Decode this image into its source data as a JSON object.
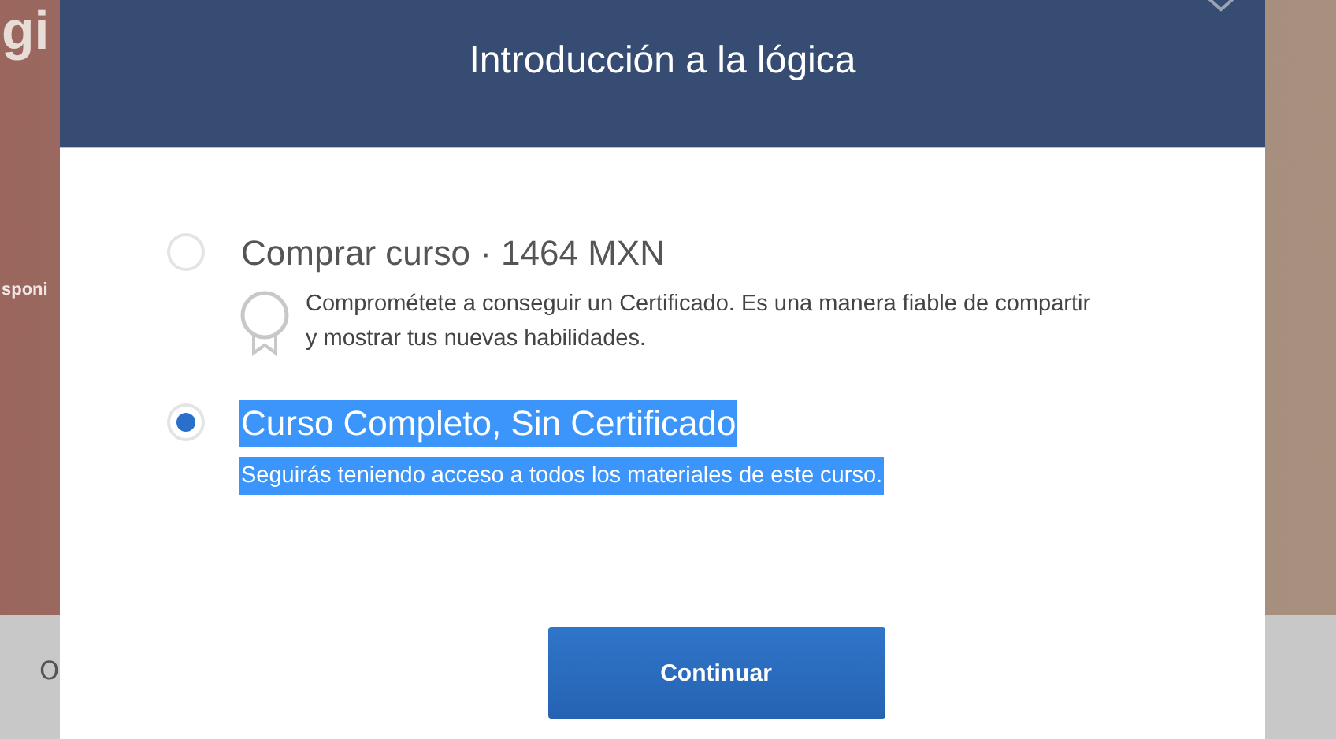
{
  "background": {
    "heading_fragment": "gi",
    "text_fragment": "sponi",
    "footer_fragment": "O"
  },
  "dialog": {
    "title": "Introducción a la lógica",
    "options": [
      {
        "kind": "purchase",
        "title": "Comprar curso · 1464 MXN",
        "description": "Comprométete a conseguir un Certificado. Es una manera fiable de compartir y mostrar tus nuevas habilidades.",
        "selected": false,
        "highlighted": false
      },
      {
        "kind": "audit",
        "title": "Curso Completo, Sin Certificado",
        "description": "Seguirás teniendo acceso a todos los materiales de este curso.",
        "selected": true,
        "highlighted": true
      }
    ],
    "button": "Continuar"
  }
}
